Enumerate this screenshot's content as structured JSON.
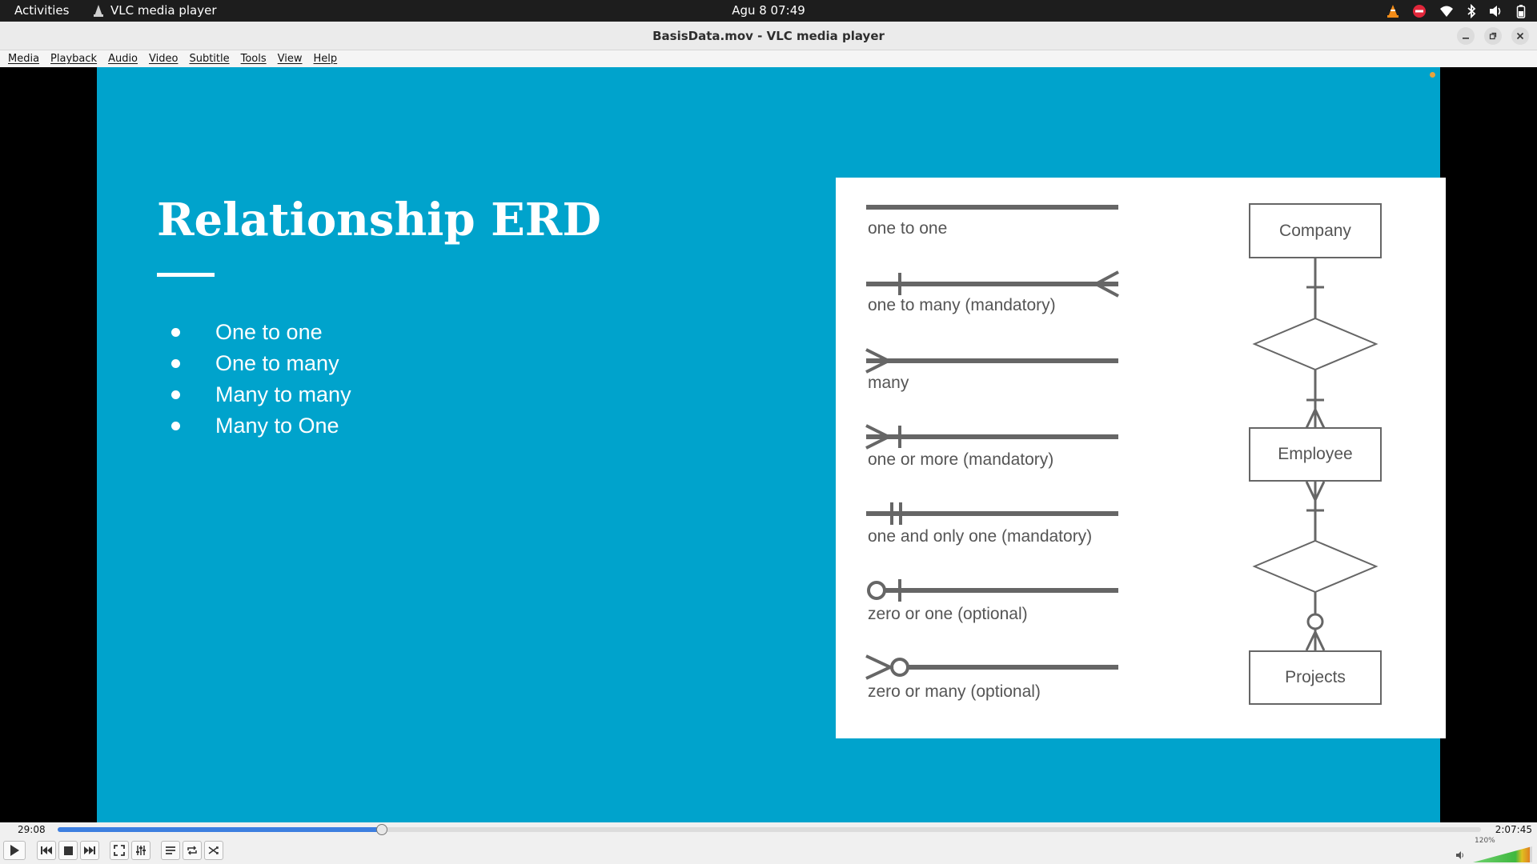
{
  "topbar": {
    "activities": "Activities",
    "app_name": "VLC media player",
    "clock": "Agu 8  07:49"
  },
  "window": {
    "title": "BasisData.mov - VLC media player"
  },
  "menu": [
    "Media",
    "Playback",
    "Audio",
    "Video",
    "Subtitle",
    "Tools",
    "View",
    "Help"
  ],
  "slide": {
    "title": "Relationship ERD",
    "bullets": [
      "One to one",
      "One to many",
      "Many to many",
      "Many to One"
    ],
    "notation": [
      "one to one",
      "one to many (mandatory)",
      "many",
      "one or more (mandatory)",
      "one and only one (mandatory)",
      "zero or one (optional)",
      "zero or many (optional)"
    ],
    "entities": [
      "Company",
      "Employee",
      "Projects"
    ]
  },
  "player": {
    "elapsed": "29:08",
    "total": "2:07:45",
    "progress": 0.228,
    "volume_label": "120%",
    "volume": 1.2
  },
  "colors": {
    "slide_bg": "#00a3cc",
    "seek_fill": "#3d7fe0"
  }
}
